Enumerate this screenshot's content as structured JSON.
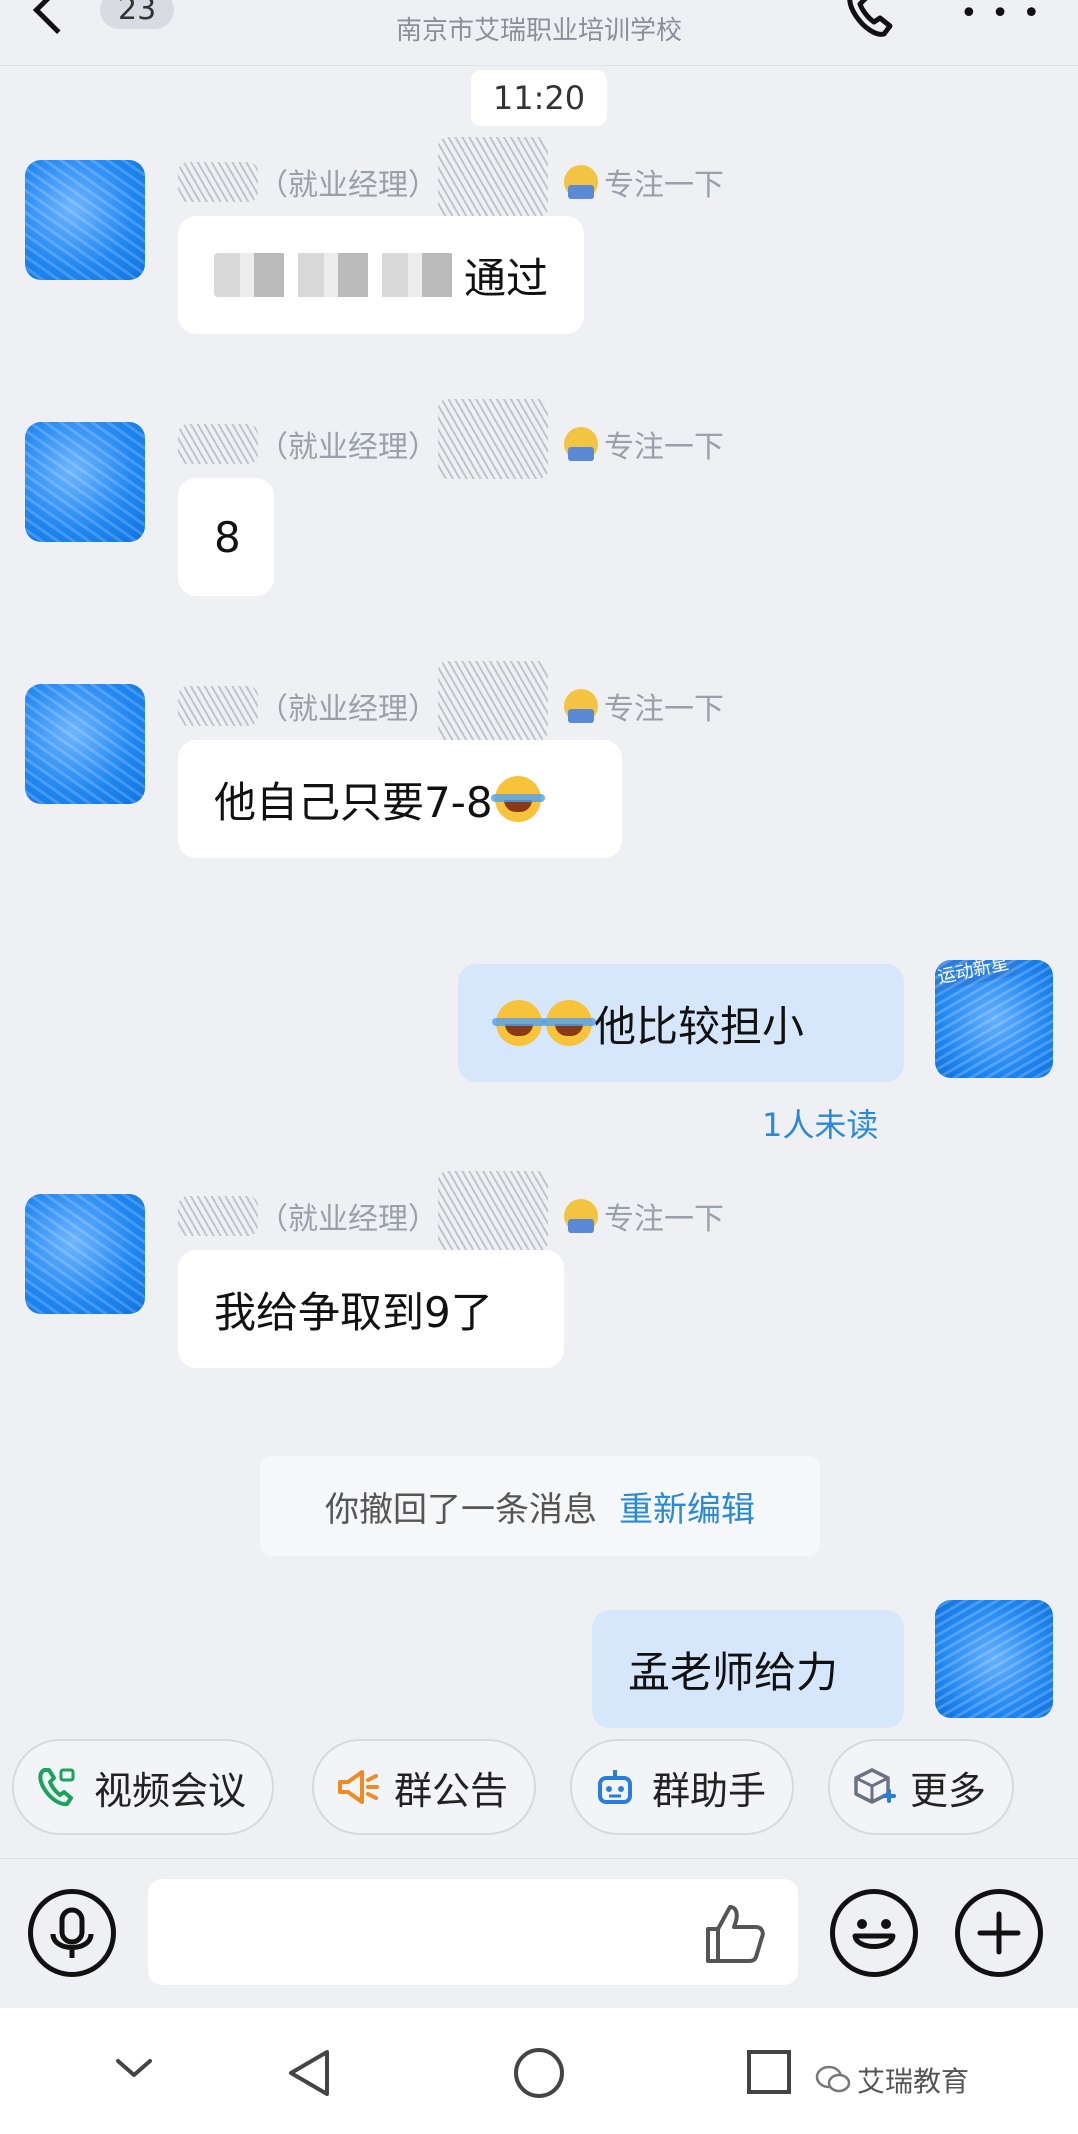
{
  "header": {
    "unread_count": "23",
    "subtitle": "南京市艾瑞职业培训学校"
  },
  "time_divider": "11:20",
  "messages": [
    {
      "sender_role": "（就业经理）",
      "status": "专注一下",
      "text": "通过"
    },
    {
      "sender_role": "（就业经理）",
      "status": "专注一下",
      "text": "8"
    },
    {
      "sender_role": "（就业经理）",
      "status": "专注一下",
      "text": "他自己只要7-8"
    },
    {
      "self": true,
      "text": "他比较担小",
      "read_status": "1人未读",
      "avatar_badge": "运动新星"
    },
    {
      "sender_role": "（就业经理）",
      "status": "专注一下",
      "text": "我给争取到9了"
    },
    {
      "self": true,
      "text": "孟老师给力"
    }
  ],
  "system_notice": {
    "text": "你撤回了一条消息",
    "action": "重新编辑"
  },
  "quick_actions": [
    {
      "label": "视频会议",
      "icon": "video-call-icon",
      "color": "#1aa35b"
    },
    {
      "label": "群公告",
      "icon": "megaphone-icon",
      "color": "#f08a24"
    },
    {
      "label": "群助手",
      "icon": "robot-icon",
      "color": "#2a7de0"
    },
    {
      "label": "更多",
      "icon": "cube-plus-icon",
      "color": "#2a7de0"
    }
  ],
  "input": {
    "placeholder": ""
  },
  "watermark": "艾瑞教育",
  "colors": {
    "accent": "#2a8ad8",
    "self_bubble": "#d6e6fb",
    "background": "#eef0f4"
  }
}
